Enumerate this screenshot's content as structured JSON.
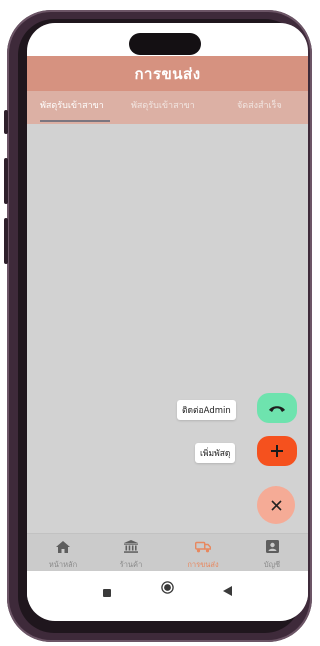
{
  "header": {
    "title": "การขนส่ง"
  },
  "tabs": [
    {
      "label": "พัสดุรับเข้าสาขา",
      "active": true
    },
    {
      "label": "พัสดุรับเข้าสาขา",
      "active": false
    },
    {
      "label": "จัดส่งสำเร็จ",
      "active": false
    }
  ],
  "fab_menu": {
    "contact_label": "ติดต่อAdmin",
    "add_label": "เพิ่มพัสดุ",
    "contact_icon": "phone-icon",
    "add_icon": "plus-icon",
    "close_icon": "close-icon",
    "colors": {
      "contact": "#6ee3ae",
      "add": "#f5511e",
      "close": "#f5ab96"
    }
  },
  "bottom_nav": {
    "items": [
      {
        "label": "หน้าหลัก",
        "icon": "home-icon",
        "active": false
      },
      {
        "label": "ร้านค้า",
        "icon": "store-icon",
        "active": false
      },
      {
        "label": "การขนส่ง",
        "icon": "truck-icon",
        "active": true
      },
      {
        "label": "บัญชี",
        "icon": "account-icon",
        "active": false
      }
    ]
  },
  "system_nav": {
    "icons": [
      "recents-icon",
      "home-circle-icon",
      "back-icon"
    ]
  },
  "colors": {
    "header": "#d69280",
    "tabbar": "#dcb0a4",
    "content": "#d2d2d2",
    "accent": "#e8885f"
  }
}
